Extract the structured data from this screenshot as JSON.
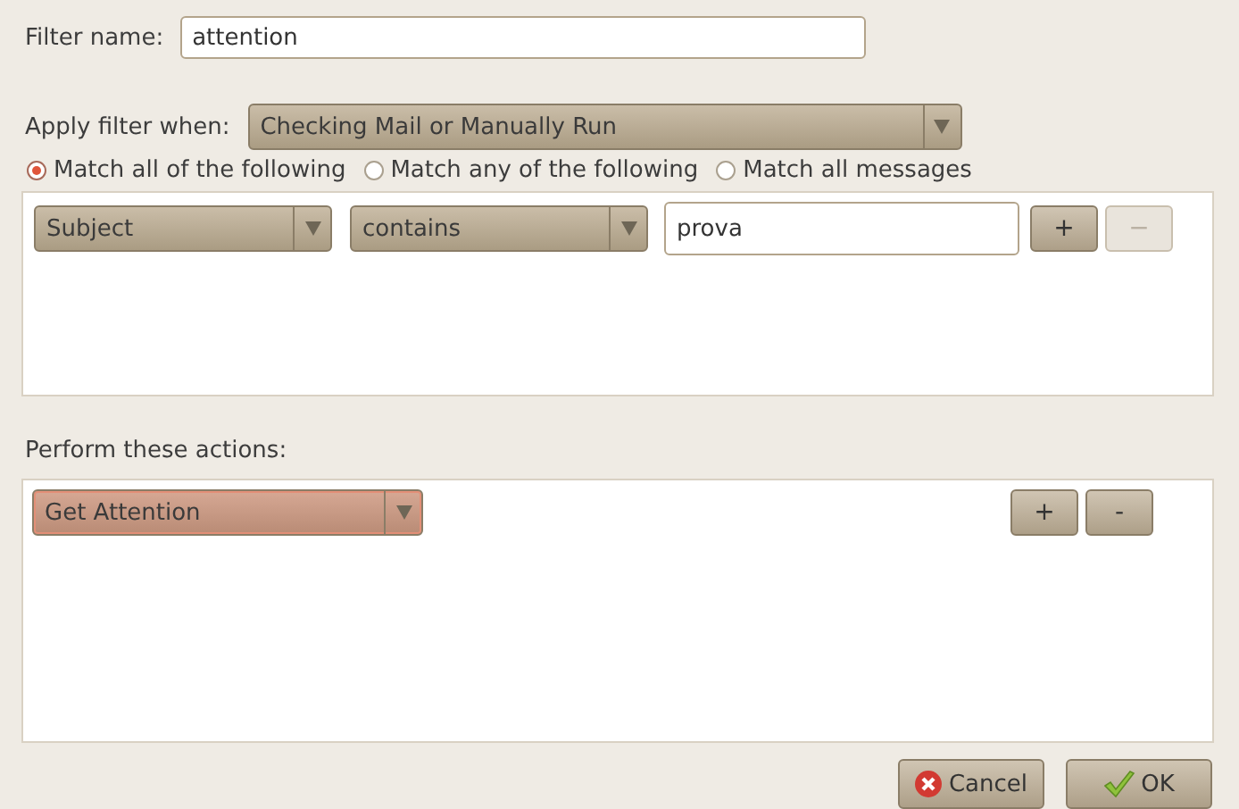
{
  "filter_name": {
    "label": "Filter name:",
    "value": "attention"
  },
  "apply_when": {
    "label": "Apply filter when:",
    "value": "Checking Mail or Manually Run"
  },
  "match_options": [
    {
      "label": "Match all of the following",
      "selected": true
    },
    {
      "label": "Match any of the following",
      "selected": false
    },
    {
      "label": "Match all messages",
      "selected": false
    }
  ],
  "rules": [
    {
      "field": "Subject",
      "operator": "contains",
      "value": "prova",
      "add_button": {
        "label": "+",
        "disabled": false
      },
      "remove_button": {
        "label": "−",
        "disabled": true
      }
    }
  ],
  "actions_label": "Perform these actions:",
  "actions": [
    {
      "action": "Get Attention",
      "focused": true,
      "add_button": {
        "label": "+",
        "disabled": false
      },
      "remove_button": {
        "label": "-",
        "disabled": false
      }
    }
  ],
  "buttons": [
    {
      "kind": "cancel",
      "label": "Cancel"
    },
    {
      "kind": "ok",
      "label": "OK"
    }
  ]
}
